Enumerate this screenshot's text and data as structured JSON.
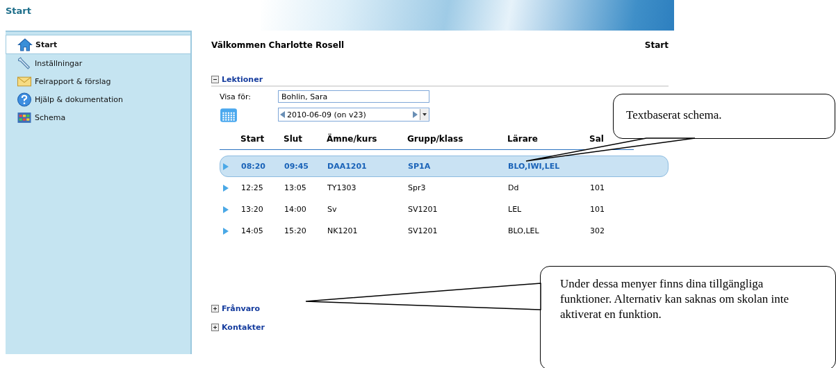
{
  "window": {
    "title": "Start"
  },
  "sidebar": {
    "items": [
      {
        "label": "Start",
        "kind": "house",
        "selected": true
      },
      {
        "label": "Inställningar",
        "kind": "wrench",
        "selected": false
      },
      {
        "label": "Felrapport & förslag",
        "kind": "envelope",
        "selected": false
      },
      {
        "label": "Hjälp & dokumentation",
        "kind": "help",
        "selected": false
      },
      {
        "label": "Schema",
        "kind": "calendar",
        "selected": false
      }
    ]
  },
  "content": {
    "welcome": "Välkommen Charlotte Rosell",
    "breadcrumb": "Start",
    "sections": [
      {
        "title": "Lektioner",
        "expanded": true
      },
      {
        "title": "Frånvaro",
        "expanded": false
      },
      {
        "title": "Kontakter",
        "expanded": false
      }
    ],
    "lessons": {
      "show_for_label": "Visa för:",
      "show_for_value": "Bohlin, Sara",
      "date": "2010-06-09 (on v23)",
      "columns": [
        "Start",
        "Slut",
        "Ämne/kurs",
        "Grupp/klass",
        "Lärare",
        "Sal"
      ],
      "rows": [
        {
          "cells": [
            "08:20",
            "09:45",
            "DAA1201",
            "SP1A",
            "BLO,IWI,LEL",
            ""
          ],
          "selected": true
        },
        {
          "cells": [
            "12:25",
            "13:05",
            "TY1303",
            "Spr3",
            "Dd",
            "101"
          ],
          "selected": false
        },
        {
          "cells": [
            "13:20",
            "14:00",
            "Sv",
            "SV1201",
            "LEL",
            "101"
          ],
          "selected": false
        },
        {
          "cells": [
            "14:05",
            "15:20",
            "NK1201",
            "SV1201",
            "BLO,LEL",
            "302"
          ],
          "selected": false
        }
      ]
    }
  },
  "callouts": [
    {
      "text": "Textbaserat schema."
    },
    {
      "text": "Under dessa menyer finns dina tillgängliga funktioner. Alternativ kan saknas om skolan inte aktiverat en funktion."
    }
  ]
}
